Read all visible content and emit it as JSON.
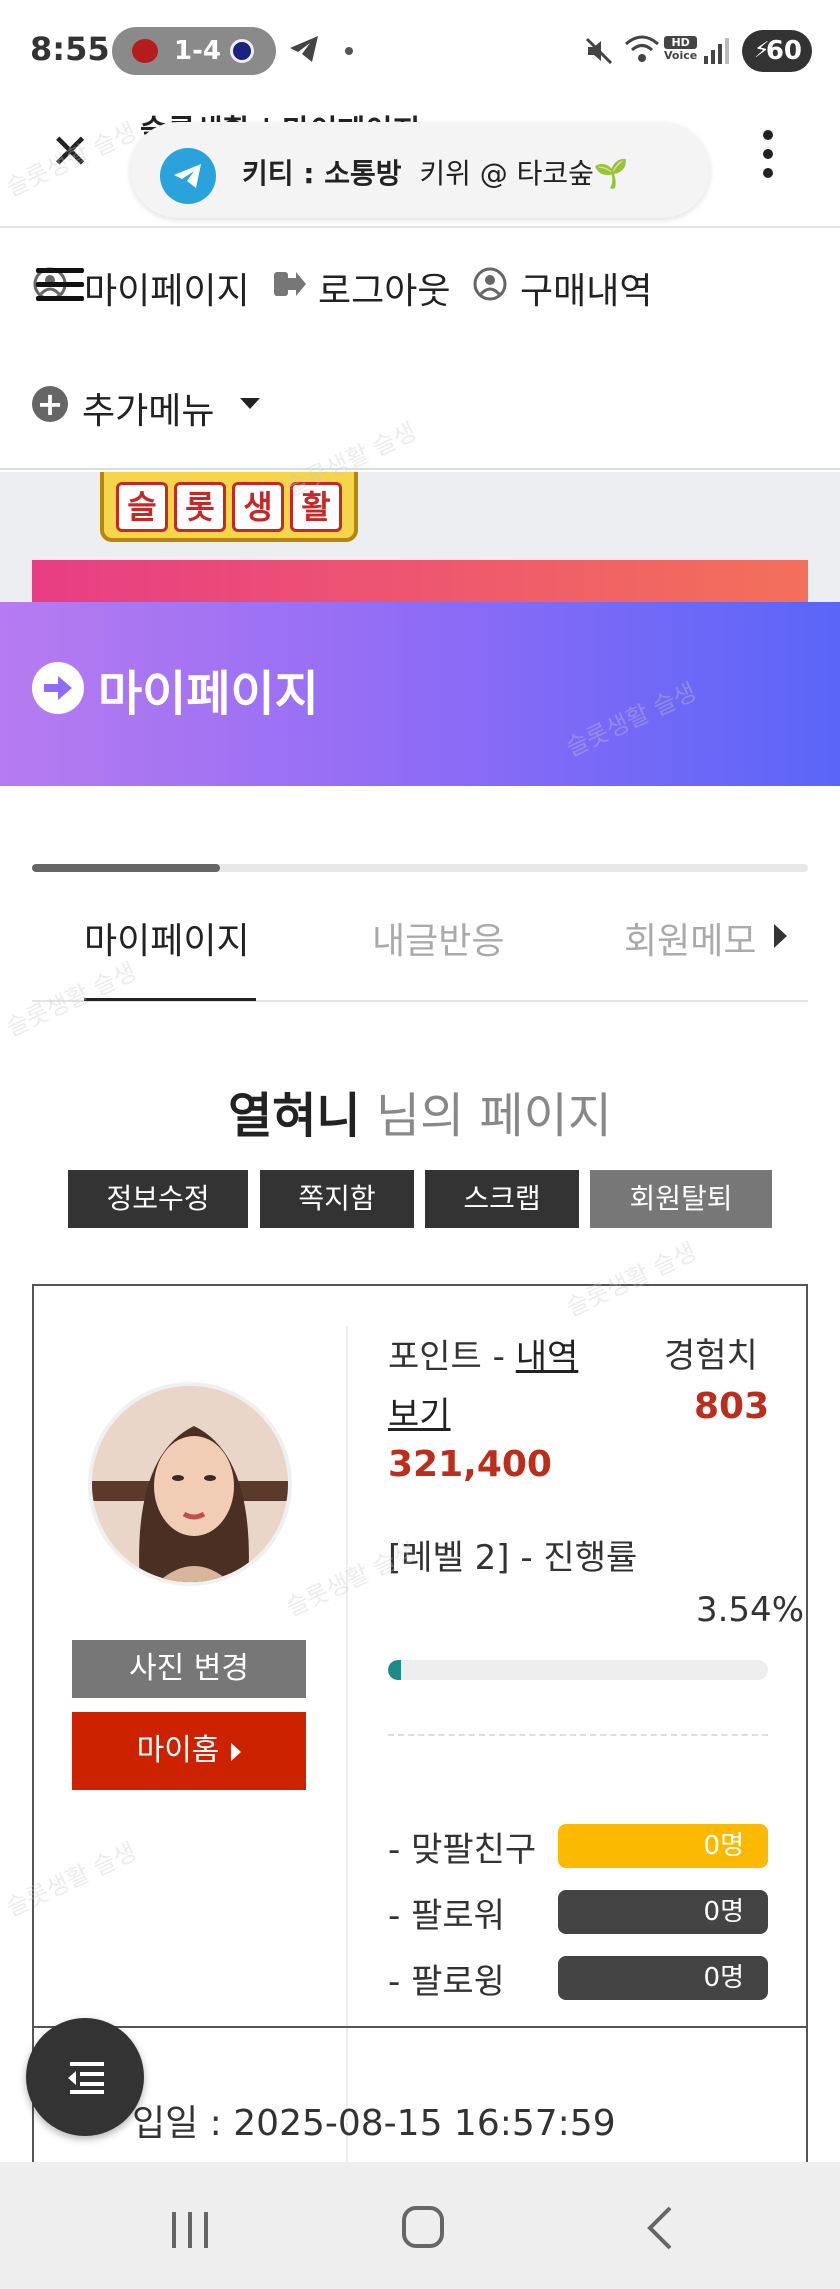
{
  "status_bar": {
    "time": "8:55",
    "score": "1-4",
    "battery": "60"
  },
  "browser": {
    "page_title": "슬롯생활 | 마이페이지",
    "toast": {
      "channel": "키티 : 소통방",
      "message": "키위 @ 타코숲🌱"
    }
  },
  "nav": {
    "mypage": "마이페이지",
    "logout": "로그아웃",
    "purchases": "구매내역",
    "more": "추가메뉴"
  },
  "logo": {
    "chars": [
      "슬",
      "롯",
      "생",
      "활"
    ]
  },
  "hero": {
    "title": "마이페이지"
  },
  "tabs": {
    "items": [
      "마이페이지",
      "내글반응",
      "회원메모"
    ],
    "active_index": 0
  },
  "profile": {
    "username": "열혀니",
    "title_suffix": "님의 페이지",
    "buttons": {
      "edit": "정보수정",
      "messages": "쪽지함",
      "scrap": "스크랩",
      "withdraw": "회원탈퇴"
    },
    "photo_button": "사진 변경",
    "home_button": "마이홈",
    "points_label": "포인트 -",
    "points_link": "내역보기",
    "points_value": "321,400",
    "exp_label": "경험치",
    "exp_value": "803",
    "level_text": "[레벨 2] - 진행률",
    "level_progress_text": "3.54%",
    "level_progress": 0.0354,
    "friends": [
      {
        "label": "- 맞팔친구",
        "value": "0명",
        "color": "#fbb900"
      },
      {
        "label": "- 팔로워",
        "value": "0명",
        "color": "#444444"
      },
      {
        "label": "- 팔로윙",
        "value": "0명",
        "color": "#444444"
      }
    ],
    "joined": "입일 : 2025-08-15 16:57:59"
  },
  "watermark": "슬롯생활 슬생",
  "colors": {
    "accent_red": "#bb2d1c",
    "hero_start": "#b77bf0",
    "hero_end": "#5a66f8",
    "level_bar": "#1a8c84"
  }
}
